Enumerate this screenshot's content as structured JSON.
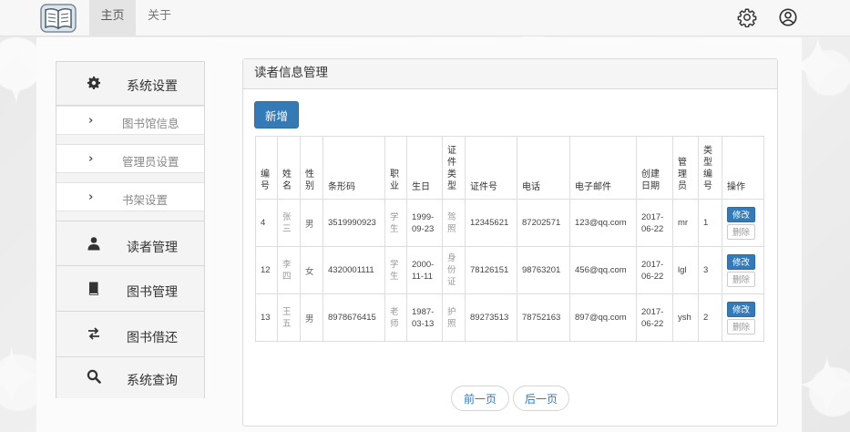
{
  "nav": {
    "home": "主页",
    "about": "关于",
    "icons": [
      "book-logo-icon",
      "gear-icon",
      "user-circle-icon"
    ]
  },
  "sidebar": {
    "settings": {
      "label": "系统设置",
      "icon": "gear-icon"
    },
    "sub": [
      {
        "label": "图书馆信息"
      },
      {
        "label": "管理员设置"
      },
      {
        "label": "书架设置"
      }
    ],
    "items": [
      {
        "label": "读者管理",
        "icon": "user-icon"
      },
      {
        "label": "图书管理",
        "icon": "book-icon"
      },
      {
        "label": "图书借还",
        "icon": "exchange-icon"
      },
      {
        "label": "系统查询",
        "icon": "search-icon"
      }
    ]
  },
  "panel": {
    "title": "读者信息管理",
    "add_label": "新增",
    "headers": [
      "编号",
      "姓名",
      "性别",
      "条形码",
      "职业",
      "生日",
      "证件类型",
      "证件号",
      "电话",
      "电子邮件",
      "创建日期",
      "管理员",
      "类型编号",
      "操作"
    ],
    "rows": [
      {
        "id": "4",
        "name": "张三",
        "gender": "男",
        "barcode": "3519990923",
        "job": "学生",
        "birth": "1999-09-23",
        "idtype": "驾照",
        "idno": "12345621",
        "phone": "87202571",
        "email": "123@qq.com",
        "created": "2017-06-22",
        "admin": "mr",
        "type": "1"
      },
      {
        "id": "12",
        "name": "李四",
        "gender": "女",
        "barcode": "4320001111",
        "job": "学生",
        "birth": "2000-11-11",
        "idtype": "身份证",
        "idno": "78126151",
        "phone": "98763201",
        "email": "456@qq.com",
        "created": "2017-06-22",
        "admin": "lgl",
        "type": "3"
      },
      {
        "id": "13",
        "name": "王五",
        "gender": "男",
        "barcode": "8978676415",
        "job": "老师",
        "birth": "1987-03-13",
        "idtype": "护照",
        "idno": "89273513",
        "phone": "78752163",
        "email": "897@qq.com",
        "created": "2017-06-22",
        "admin": "ysh",
        "type": "2"
      }
    ],
    "edit_label": "修改",
    "delete_label": "删除",
    "prev_label": "前一页",
    "next_label": "后一页"
  },
  "colors": {
    "primary": "#337ab7",
    "nav_bg": "#f7f7f7",
    "page_bg": "#ececec"
  }
}
